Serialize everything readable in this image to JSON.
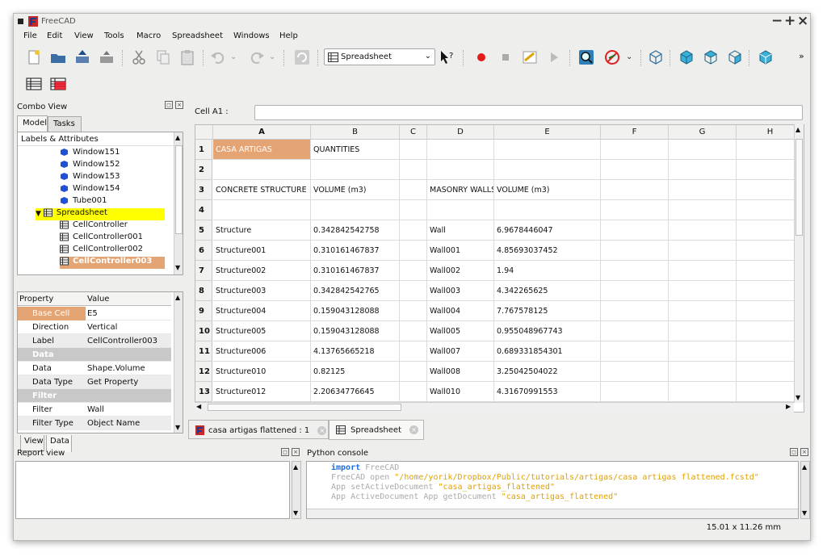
{
  "window": {
    "title": "FreeCAD"
  },
  "menu": [
    "File",
    "Edit",
    "View",
    "Tools",
    "Macro",
    "Spreadsheet",
    "Windows",
    "Help"
  ],
  "toolbar": {
    "workbench_label": "Spreadsheet",
    "overflow": "»"
  },
  "combo": {
    "title": "Combo View",
    "tabs": [
      "Model",
      "Tasks"
    ],
    "tree_header": "Labels & Attributes",
    "tree_items": [
      {
        "label": "Window151",
        "icon": "solid-icon"
      },
      {
        "label": "Window152",
        "icon": "solid-icon"
      },
      {
        "label": "Window153",
        "icon": "solid-icon"
      },
      {
        "label": "Window154",
        "icon": "solid-icon"
      },
      {
        "label": "Tube001",
        "icon": "solid-icon"
      },
      {
        "label": "Spreadsheet",
        "icon": "spreadsheet-icon"
      },
      {
        "label": "CellController",
        "icon": "cellcontroller-icon"
      },
      {
        "label": "CellController001",
        "icon": "cellcontroller-icon"
      },
      {
        "label": "CellController002",
        "icon": "cellcontroller-icon"
      },
      {
        "label": "CellController003",
        "icon": "cellcontroller-icon"
      }
    ],
    "prop_header": [
      "Property",
      "Value"
    ],
    "properties": [
      {
        "key": "Base Cell",
        "value": "E5"
      },
      {
        "key": "Direction",
        "value": "Vertical"
      },
      {
        "key": "Label",
        "value": "CellController003"
      },
      {
        "key": "Data",
        "value": ""
      },
      {
        "key": "Data",
        "value": "Shape.Volume"
      },
      {
        "key": "Data Type",
        "value": "Get Property"
      },
      {
        "key": "Filter",
        "value": ""
      },
      {
        "key": "Filter",
        "value": "Wall"
      },
      {
        "key": "Filter Type",
        "value": "Object Name"
      }
    ],
    "view_tabs": [
      "View",
      "Data"
    ]
  },
  "sheet": {
    "cell_label": "Cell A1 :",
    "cell_value": "",
    "columns": [
      "A",
      "B",
      "C",
      "D",
      "E",
      "F",
      "G",
      "H"
    ],
    "rows": [
      {
        "n": "1",
        "cells": [
          "CASA ARTIGAS",
          "QUANTITIES",
          "",
          "",
          "",
          "",
          "",
          ""
        ]
      },
      {
        "n": "2",
        "cells": [
          "",
          "",
          "",
          "",
          "",
          "",
          "",
          ""
        ]
      },
      {
        "n": "3",
        "cells": [
          "CONCRETE STRUCTURE",
          "VOLUME (m3)",
          "",
          "MASONRY WALLS",
          "VOLUME (m3)",
          "",
          "",
          ""
        ]
      },
      {
        "n": "4",
        "cells": [
          "",
          "",
          "",
          "",
          "",
          "",
          "",
          ""
        ]
      },
      {
        "n": "5",
        "cells": [
          "Structure",
          "0.342842542758",
          "",
          "Wall",
          "6.9678446047",
          "",
          "",
          ""
        ]
      },
      {
        "n": "6",
        "cells": [
          "Structure001",
          "0.310161467837",
          "",
          "Wall001",
          "4.85693037452",
          "",
          "",
          ""
        ]
      },
      {
        "n": "7",
        "cells": [
          "Structure002",
          "0.310161467837",
          "",
          "Wall002",
          "1.94",
          "",
          "",
          ""
        ]
      },
      {
        "n": "8",
        "cells": [
          "Structure003",
          "0.342842542765",
          "",
          "Wall003",
          "4.342265625",
          "",
          "",
          ""
        ]
      },
      {
        "n": "9",
        "cells": [
          "Structure004",
          "0.159043128088",
          "",
          "Wall004",
          "7.767578125",
          "",
          "",
          ""
        ]
      },
      {
        "n": "10",
        "cells": [
          "Structure005",
          "0.159043128088",
          "",
          "Wall005",
          "0.955048967743",
          "",
          "",
          ""
        ]
      },
      {
        "n": "11",
        "cells": [
          "Structure006",
          "4.13765665218",
          "",
          "Wall007",
          "0.689331854301",
          "",
          "",
          ""
        ]
      },
      {
        "n": "12",
        "cells": [
          "Structure010",
          "0.82125",
          "",
          "Wall008",
          "3.25042504022",
          "",
          "",
          ""
        ]
      },
      {
        "n": "13",
        "cells": [
          "Structure012",
          "2.20634776645",
          "",
          "Wall010",
          "4.31670991553",
          "",
          "",
          ""
        ]
      }
    ]
  },
  "doc_tabs": [
    "casa artigas flattened : 1",
    "Spreadsheet"
  ],
  "report": {
    "title": "Report view"
  },
  "python": {
    "title": "Python console",
    "lines": [
      {
        "kw": "import",
        "rest": " FreeCAD",
        "str": ""
      },
      {
        "kw": "",
        "rest": "FreeCAD open ",
        "str": "\"/home/yorik/Dropbox/Public/tutorials/artigas/casa artigas flattened.fcstd\""
      },
      {
        "kw": "",
        "rest": "App setActiveDocument ",
        "str": "\"casa_artigas_flattened\""
      },
      {
        "kw": "",
        "rest": "App ActiveDocument App getDocument ",
        "str": "\"casa_artigas_flattened\""
      }
    ]
  },
  "status": {
    "dims": "15.01 x 11.26 mm"
  },
  "colors": {
    "highlight": "#e5a473",
    "selection_yellow": "#ffff00",
    "keyword": "#1d6fe0",
    "string": "#e0a100"
  }
}
